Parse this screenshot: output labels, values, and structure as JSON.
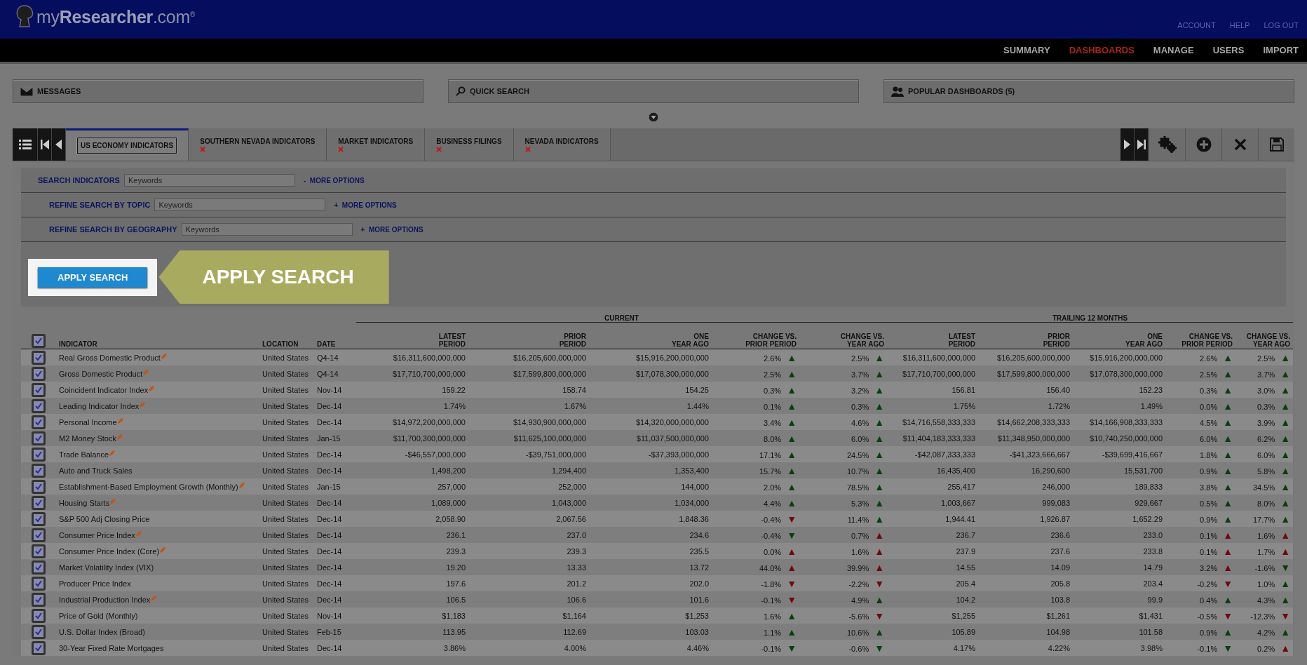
{
  "brand": {
    "logo": "my**Researcher**.com$^{®}$"
  },
  "utility_links": [
    "ACCOUNT",
    "HELP",
    "LOG OUT"
  ],
  "nav": [
    {
      "label": "SUMMARY",
      "selected": false
    },
    {
      "label": "DASHBOARDS",
      "selected": true
    },
    {
      "label": "MANAGE",
      "selected": false
    },
    {
      "label": "USERS",
      "selected": false
    },
    {
      "label": "IMPORT",
      "selected": false
    }
  ],
  "panels": [
    {
      "label": "MESSAGES",
      "kind": "mail"
    },
    {
      "label": "QUICK SEARCH",
      "kind": "search"
    },
    {
      "label": "POPULAR DASHBOARDS (5)",
      "kind": "people"
    }
  ],
  "tabs": [
    {
      "label": "US ECONOMY INDICATORS",
      "selected": true,
      "closable": false
    },
    {
      "label": "SOUTHERN NEVADA INDICATORS",
      "selected": false,
      "closable": true
    },
    {
      "label": "MARKET INDICATORS",
      "selected": false,
      "closable": true
    },
    {
      "label": "BUSINESS FILINGS",
      "selected": false,
      "closable": true
    },
    {
      "label": "NEVADA INDICATORS",
      "selected": false,
      "closable": true
    }
  ],
  "search_rows": [
    {
      "label": "SEARCH INDICATORS",
      "placeholder": "Keywords",
      "toggle": "-",
      "options": "MORE OPTIONS"
    },
    {
      "label": "REFINE SEARCH BY TOPIC",
      "placeholder": "Keywords",
      "toggle": "+",
      "options": "MORE OPTIONS"
    },
    {
      "label": "REFINE SEARCH BY GEOGRAPHY",
      "placeholder": "Keywords",
      "toggle": "+",
      "options": "MORE OPTIONS"
    }
  ],
  "apply_button": "APPLY SEARCH",
  "callout": "APPLY SEARCH",
  "table": {
    "all_checked": true,
    "groups": [
      "CURRENT",
      "TRAILING 12 MONTHS"
    ],
    "columns": [
      [
        "INDICATOR"
      ],
      [
        "LOCATION"
      ],
      [
        "DATE"
      ],
      [
        "LATEST",
        "PERIOD"
      ],
      [
        "PRIOR",
        "PERIOD"
      ],
      [
        "ONE",
        "YEAR AGO"
      ],
      [
        "CHANGE VS.",
        "PRIOR PERIOD"
      ],
      [
        "CHANGE VS.",
        "YEAR AGO"
      ],
      [
        "LATEST",
        "PERIOD"
      ],
      [
        "PRIOR",
        "PERIOD"
      ],
      [
        "ONE",
        "YEAR AGO"
      ],
      [
        "CHANGE VS.",
        "PRIOR PERIOD"
      ],
      [
        "CHANGE VS.",
        "YEAR AGO"
      ]
    ],
    "rows": [
      {
        "checked": true,
        "indicator": "Real Gross Domestic Product",
        "noted": true,
        "location": "United States",
        "date": "Q4-14",
        "current": [
          "$16,311,600,000,000",
          "$16,205,600,000,000",
          "$15,916,200,000,000"
        ],
        "current_changes": [
          {
            "value": "2.6%",
            "arrow": "▲",
            "color": "#084008"
          },
          {
            "value": "2.5%",
            "arrow": "▲",
            "color": "#084008"
          }
        ],
        "trailing": [
          "$16,311,600,000,000",
          "$16,205,600,000,000",
          "$15,916,200,000,000"
        ],
        "trailing_changes": [
          {
            "value": "2.6%",
            "arrow": "▲",
            "color": "#084008"
          },
          {
            "value": "2.5%",
            "arrow": "▲",
            "color": "#084008"
          }
        ]
      },
      {
        "checked": true,
        "indicator": "Gross Domestic Product",
        "noted": true,
        "location": "United States",
        "date": "Q4-14",
        "current": [
          "$17,710,700,000,000",
          "$17,599,800,000,000",
          "$17,078,300,000,000"
        ],
        "current_changes": [
          {
            "value": "2.5%",
            "arrow": "▲",
            "color": "#084008"
          },
          {
            "value": "3.7%",
            "arrow": "▲",
            "color": "#084008"
          }
        ],
        "trailing": [
          "$17,710,700,000,000",
          "$17,599,800,000,000",
          "$17,078,300,000,000"
        ],
        "trailing_changes": [
          {
            "value": "2.5%",
            "arrow": "▲",
            "color": "#084008"
          },
          {
            "value": "3.7%",
            "arrow": "▲",
            "color": "#084008"
          }
        ]
      },
      {
        "checked": true,
        "indicator": "Coincident Indicator Index",
        "noted": true,
        "location": "United States",
        "date": "Nov-14",
        "current": [
          "159.22",
          "158.74",
          "154.25"
        ],
        "current_changes": [
          {
            "value": "0.3%",
            "arrow": "▲",
            "color": "#084008"
          },
          {
            "value": "3.2%",
            "arrow": "▲",
            "color": "#084008"
          }
        ],
        "trailing": [
          "156.81",
          "156.40",
          "152.23"
        ],
        "trailing_changes": [
          {
            "value": "0.3%",
            "arrow": "▲",
            "color": "#084008"
          },
          {
            "value": "3.0%",
            "arrow": "▲",
            "color": "#084008"
          }
        ]
      },
      {
        "checked": true,
        "indicator": "Leading Indicator Index",
        "noted": true,
        "location": "United States",
        "date": "Dec-14",
        "current": [
          "1.74%",
          "1.67%",
          "1.44%"
        ],
        "current_changes": [
          {
            "value": "0.1%",
            "arrow": "▲",
            "color": "#084008"
          },
          {
            "value": "0.3%",
            "arrow": "▲",
            "color": "#084008"
          }
        ],
        "trailing": [
          "1.75%",
          "1.72%",
          "1.49%"
        ],
        "trailing_changes": [
          {
            "value": "0.0%",
            "arrow": "▲",
            "color": "#084008"
          },
          {
            "value": "0.3%",
            "arrow": "▲",
            "color": "#084008"
          }
        ]
      },
      {
        "checked": true,
        "indicator": "Personal Income",
        "noted": true,
        "location": "United States",
        "date": "Dec-14",
        "current": [
          "$14,972,200,000,000",
          "$14,930,900,000,000",
          "$14,320,000,000,000"
        ],
        "current_changes": [
          {
            "value": "3.4%",
            "arrow": "▲",
            "color": "#084008"
          },
          {
            "value": "4.6%",
            "arrow": "▲",
            "color": "#084008"
          }
        ],
        "trailing": [
          "$14,716,558,333,333",
          "$14,662,208,333,333",
          "$14,166,908,333,333"
        ],
        "trailing_changes": [
          {
            "value": "4.5%",
            "arrow": "▲",
            "color": "#084008"
          },
          {
            "value": "3.9%",
            "arrow": "▲",
            "color": "#084008"
          }
        ]
      },
      {
        "checked": true,
        "indicator": "M2 Money Stock",
        "noted": true,
        "location": "United States",
        "date": "Jan-15",
        "current": [
          "$11,700,300,000,000",
          "$11,625,100,000,000",
          "$11,037,500,000,000"
        ],
        "current_changes": [
          {
            "value": "8.0%",
            "arrow": "▲",
            "color": "#084008"
          },
          {
            "value": "6.0%",
            "arrow": "▲",
            "color": "#084008"
          }
        ],
        "trailing": [
          "$11,404,183,333,333",
          "$11,348,950,000,000",
          "$10,740,250,000,000"
        ],
        "trailing_changes": [
          {
            "value": "6.0%",
            "arrow": "▲",
            "color": "#084008"
          },
          {
            "value": "6.2%",
            "arrow": "▲",
            "color": "#084008"
          }
        ]
      },
      {
        "checked": true,
        "indicator": "Trade Balance",
        "noted": true,
        "location": "United States",
        "date": "Dec-14",
        "current": [
          "-$46,557,000,000",
          "-$39,751,000,000",
          "-$37,393,000,000"
        ],
        "current_changes": [
          {
            "value": "17.1%",
            "arrow": "▲",
            "color": "#084008"
          },
          {
            "value": "24.5%",
            "arrow": "▲",
            "color": "#084008"
          }
        ],
        "trailing": [
          "-$42,087,333,333",
          "-$41,323,666,667",
          "-$39,699,416,667"
        ],
        "trailing_changes": [
          {
            "value": "1.8%",
            "arrow": "▲",
            "color": "#084008"
          },
          {
            "value": "6.0%",
            "arrow": "▲",
            "color": "#084008"
          }
        ]
      },
      {
        "checked": true,
        "indicator": "Auto and Truck Sales",
        "noted": false,
        "location": "United States",
        "date": "Dec-14",
        "current": [
          "1,498,200",
          "1,294,400",
          "1,353,400"
        ],
        "current_changes": [
          {
            "value": "15.7%",
            "arrow": "▲",
            "color": "#084008"
          },
          {
            "value": "10.7%",
            "arrow": "▲",
            "color": "#084008"
          }
        ],
        "trailing": [
          "16,435,400",
          "16,290,600",
          "15,531,700"
        ],
        "trailing_changes": [
          {
            "value": "0.9%",
            "arrow": "▲",
            "color": "#084008"
          },
          {
            "value": "5.8%",
            "arrow": "▲",
            "color": "#084008"
          }
        ]
      },
      {
        "checked": true,
        "indicator": "Establishment-Based Employment Growth (Monthly)",
        "noted": true,
        "location": "United States",
        "date": "Jan-15",
        "current": [
          "257,000",
          "252,000",
          "144,000"
        ],
        "current_changes": [
          {
            "value": "2.0%",
            "arrow": "▲",
            "color": "#084008"
          },
          {
            "value": "78.5%",
            "arrow": "▲",
            "color": "#084008"
          }
        ],
        "trailing": [
          "255,417",
          "246,000",
          "189,833"
        ],
        "trailing_changes": [
          {
            "value": "3.8%",
            "arrow": "▲",
            "color": "#084008"
          },
          {
            "value": "34.5%",
            "arrow": "▲",
            "color": "#084008"
          }
        ]
      },
      {
        "checked": true,
        "indicator": "Housing Starts",
        "noted": true,
        "location": "United States",
        "date": "Dec-14",
        "current": [
          "1,089,000",
          "1,043,000",
          "1,034,000"
        ],
        "current_changes": [
          {
            "value": "4.4%",
            "arrow": "▲",
            "color": "#084008"
          },
          {
            "value": "5.3%",
            "arrow": "▲",
            "color": "#084008"
          }
        ],
        "trailing": [
          "1,003,667",
          "999,083",
          "929,667"
        ],
        "trailing_changes": [
          {
            "value": "0.5%",
            "arrow": "▲",
            "color": "#084008"
          },
          {
            "value": "8.0%",
            "arrow": "▲",
            "color": "#084008"
          }
        ]
      },
      {
        "checked": true,
        "indicator": "S&P 500 Adj Closing Price",
        "noted": false,
        "location": "United States",
        "date": "Dec-14",
        "current": [
          "2,058.90",
          "2,067.56",
          "1,848.36"
        ],
        "current_changes": [
          {
            "value": "-0.4%",
            "arrow": "▼",
            "color": "#6e0a0a"
          },
          {
            "value": "11.4%",
            "arrow": "▲",
            "color": "#084008"
          }
        ],
        "trailing": [
          "1,944.41",
          "1,926.87",
          "1,652.29"
        ],
        "trailing_changes": [
          {
            "value": "0.9%",
            "arrow": "▲",
            "color": "#084008"
          },
          {
            "value": "17.7%",
            "arrow": "▲",
            "color": "#084008"
          }
        ]
      },
      {
        "checked": true,
        "indicator": "Consumer Price Index",
        "noted": true,
        "location": "United States",
        "date": "Dec-14",
        "current": [
          "236.1",
          "237.0",
          "234.6"
        ],
        "current_changes": [
          {
            "value": "-0.4%",
            "arrow": "▼",
            "color": "#084008"
          },
          {
            "value": "0.7%",
            "arrow": "▲",
            "color": "#6e0a0a"
          }
        ],
        "trailing": [
          "236.7",
          "236.6",
          "233.0"
        ],
        "trailing_changes": [
          {
            "value": "0.1%",
            "arrow": "▲",
            "color": "#6e0a0a"
          },
          {
            "value": "1.6%",
            "arrow": "▲",
            "color": "#6e0a0a"
          }
        ]
      },
      {
        "checked": true,
        "indicator": "Consumer Price Index (Core)",
        "noted": true,
        "location": "United States",
        "date": "Dec-14",
        "current": [
          "239.3",
          "239.3",
          "235.5"
        ],
        "current_changes": [
          {
            "value": "0.0%",
            "arrow": "▲",
            "color": "#6e0a0a"
          },
          {
            "value": "1.6%",
            "arrow": "▲",
            "color": "#6e0a0a"
          }
        ],
        "trailing": [
          "237.9",
          "237.6",
          "233.8"
        ],
        "trailing_changes": [
          {
            "value": "0.1%",
            "arrow": "▲",
            "color": "#6e0a0a"
          },
          {
            "value": "1.7%",
            "arrow": "▲",
            "color": "#6e0a0a"
          }
        ]
      },
      {
        "checked": true,
        "indicator": "Market Volatility Index (VIX)",
        "noted": false,
        "location": "United States",
        "date": "Dec-14",
        "current": [
          "19.20",
          "13.33",
          "13.72"
        ],
        "current_changes": [
          {
            "value": "44.0%",
            "arrow": "▲",
            "color": "#6e0a0a"
          },
          {
            "value": "39.9%",
            "arrow": "▲",
            "color": "#6e0a0a"
          }
        ],
        "trailing": [
          "14.55",
          "14.09",
          "14.79"
        ],
        "trailing_changes": [
          {
            "value": "3.2%",
            "arrow": "▲",
            "color": "#6e0a0a"
          },
          {
            "value": "-1.6%",
            "arrow": "▼",
            "color": "#084008"
          }
        ]
      },
      {
        "checked": true,
        "indicator": "Producer Price Index",
        "noted": false,
        "location": "United States",
        "date": "Dec-14",
        "current": [
          "197.6",
          "201.2",
          "202.0"
        ],
        "current_changes": [
          {
            "value": "-1.8%",
            "arrow": "▼",
            "color": "#6e0a0a"
          },
          {
            "value": "-2.2%",
            "arrow": "▼",
            "color": "#6e0a0a"
          }
        ],
        "trailing": [
          "205.4",
          "205.8",
          "203.4"
        ],
        "trailing_changes": [
          {
            "value": "-0.2%",
            "arrow": "▼",
            "color": "#6e0a0a"
          },
          {
            "value": "1.0%",
            "arrow": "▲",
            "color": "#084008"
          }
        ]
      },
      {
        "checked": true,
        "indicator": "Industrial Production Index",
        "noted": true,
        "location": "United States",
        "date": "Dec-14",
        "current": [
          "106.5",
          "106.6",
          "101.6"
        ],
        "current_changes": [
          {
            "value": "-0.1%",
            "arrow": "▼",
            "color": "#6e0a0a"
          },
          {
            "value": "4.9%",
            "arrow": "▲",
            "color": "#084008"
          }
        ],
        "trailing": [
          "104.2",
          "103.8",
          "99.9"
        ],
        "trailing_changes": [
          {
            "value": "0.4%",
            "arrow": "▲",
            "color": "#084008"
          },
          {
            "value": "4.3%",
            "arrow": "▲",
            "color": "#084008"
          }
        ]
      },
      {
        "checked": true,
        "indicator": "Price of Gold (Monthly)",
        "noted": false,
        "location": "United States",
        "date": "Nov-14",
        "current": [
          "$1,183",
          "$1,164",
          "$1,253"
        ],
        "current_changes": [
          {
            "value": "1.6%",
            "arrow": "▲",
            "color": "#084008"
          },
          {
            "value": "-5.6%",
            "arrow": "▼",
            "color": "#6e0a0a"
          }
        ],
        "trailing": [
          "$1,255",
          "$1,261",
          "$1,431"
        ],
        "trailing_changes": [
          {
            "value": "-0.5%",
            "arrow": "▼",
            "color": "#6e0a0a"
          },
          {
            "value": "-12.3%",
            "arrow": "▼",
            "color": "#6e0a0a"
          }
        ]
      },
      {
        "checked": true,
        "indicator": "U.S. Dollar Index (Broad)",
        "noted": false,
        "location": "United States",
        "date": "Feb-15",
        "current": [
          "113.95",
          "112.69",
          "103.03"
        ],
        "current_changes": [
          {
            "value": "1.1%",
            "arrow": "▲",
            "color": "#084008"
          },
          {
            "value": "10.6%",
            "arrow": "▲",
            "color": "#084008"
          }
        ],
        "trailing": [
          "105.89",
          "104.98",
          "101.58"
        ],
        "trailing_changes": [
          {
            "value": "0.9%",
            "arrow": "▲",
            "color": "#084008"
          },
          {
            "value": "4.2%",
            "arrow": "▲",
            "color": "#084008"
          }
        ]
      },
      {
        "checked": true,
        "indicator": "30-Year Fixed Rate Mortgages",
        "noted": false,
        "location": "United States",
        "date": "Dec-14",
        "current": [
          "3.86%",
          "4.00%",
          "4.46%"
        ],
        "current_changes": [
          {
            "value": "-0.1%",
            "arrow": "▼",
            "color": "#084008"
          },
          {
            "value": "-0.6%",
            "arrow": "▼",
            "color": "#084008"
          }
        ],
        "trailing": [
          "4.17%",
          "4.22%",
          "3.98%"
        ],
        "trailing_changes": [
          {
            "value": "-0.1%",
            "arrow": "▼",
            "color": "#084008"
          },
          {
            "value": "0.2%",
            "arrow": "▲",
            "color": "#6e0a0a"
          }
        ]
      }
    ]
  }
}
